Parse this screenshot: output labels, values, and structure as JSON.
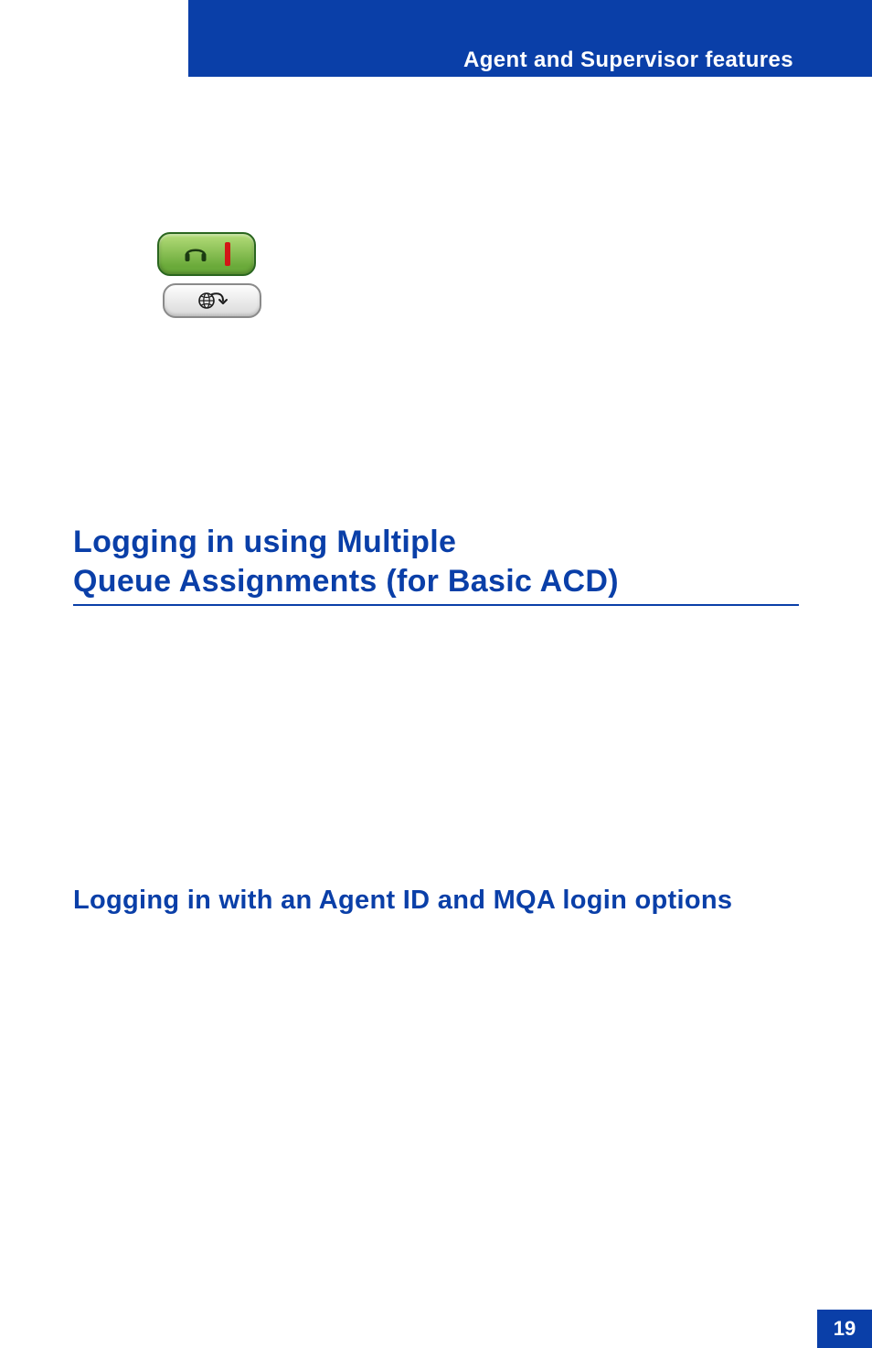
{
  "header": {
    "title": "Agent and Supervisor features"
  },
  "icons": {
    "headset": "headset-icon",
    "globe_arrow": "globe-arrow-icon"
  },
  "sections": {
    "mqa_login_heading_line1": "Logging in using Multiple",
    "mqa_login_heading_line2": "Queue Assignments (for Basic ACD)",
    "agent_id_sub_heading": "Logging in with an Agent ID and MQA login options"
  },
  "footer": {
    "page_number": "19"
  }
}
